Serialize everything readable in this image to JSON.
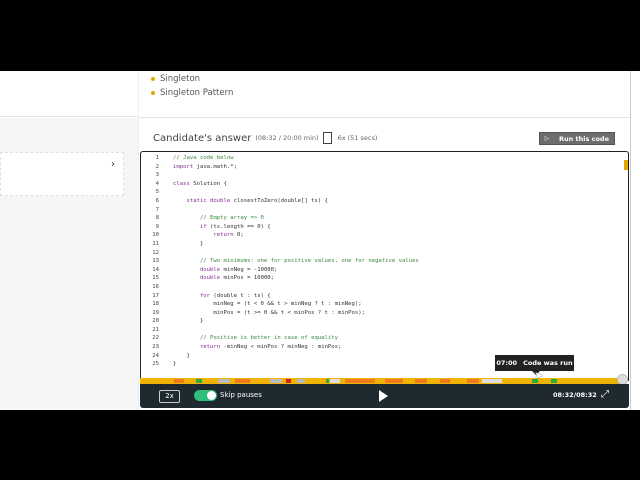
{
  "tags": [
    "Singleton",
    "Singleton Pattern"
  ],
  "left_card": {
    "chevron": "›"
  },
  "answer": {
    "title": "Candidate's answer",
    "time": "(08:32 / 20:00 min)",
    "paste_count": "6x (51 secs)"
  },
  "run_button": {
    "icon": "▷",
    "label": "Run this code"
  },
  "code": [
    [
      [
        "// Java code below",
        "c"
      ]
    ],
    [
      [
        "import ",
        "k"
      ],
      [
        "java.math.*;",
        ""
      ]
    ],
    [
      [
        "",
        ""
      ]
    ],
    [
      [
        "class ",
        "k"
      ],
      [
        "Solution {",
        ""
      ]
    ],
    [
      [
        "",
        ""
      ]
    ],
    [
      [
        "    static double ",
        "k"
      ],
      [
        "closestToZero(double[] ts) {",
        ""
      ]
    ],
    [
      [
        "",
        ""
      ]
    ],
    [
      [
        "        // Empty array => 0",
        "c"
      ]
    ],
    [
      [
        "        if ",
        "k"
      ],
      [
        "(ts.length == 0) {",
        ""
      ]
    ],
    [
      [
        "            return ",
        "k"
      ],
      [
        "0;",
        ""
      ]
    ],
    [
      [
        "        }",
        ""
      ]
    ],
    [
      [
        "",
        ""
      ]
    ],
    [
      [
        "        // Two minimums: one for positive values, one for negative values",
        "c"
      ]
    ],
    [
      [
        "        double ",
        "k"
      ],
      [
        "minNeg = -10000;",
        ""
      ]
    ],
    [
      [
        "        double ",
        "k"
      ],
      [
        "minPos = 10000;",
        ""
      ]
    ],
    [
      [
        "",
        ""
      ]
    ],
    [
      [
        "        for ",
        "k"
      ],
      [
        "(double t : ts) {",
        ""
      ]
    ],
    [
      [
        "            minNeg = (t < 0 && t > minNeg ? t : minNeg);",
        ""
      ]
    ],
    [
      [
        "            minPos = (t >= 0 && t < minPos ? t : minPos);",
        ""
      ]
    ],
    [
      [
        "        }",
        ""
      ]
    ],
    [
      [
        "",
        ""
      ]
    ],
    [
      [
        "        // Positive is better in case of equality",
        "c"
      ]
    ],
    [
      [
        "        return ",
        "k"
      ],
      [
        "-minNeg < minPos ? minNeg : minPos;",
        ""
      ]
    ],
    [
      [
        "    }",
        ""
      ]
    ],
    [
      [
        "}",
        ""
      ]
    ]
  ],
  "tooltip": {
    "time": "07:00",
    "label": "Code was run"
  },
  "player": {
    "speed": "2x",
    "skip_pauses": "Skip pauses",
    "skip_pauses_on": true,
    "time": "08:32/08:32",
    "progress": 1.0
  },
  "colors": {
    "accent": "#f0b400",
    "toggle": "#2fbf7a",
    "bar": "#1f2a30"
  }
}
